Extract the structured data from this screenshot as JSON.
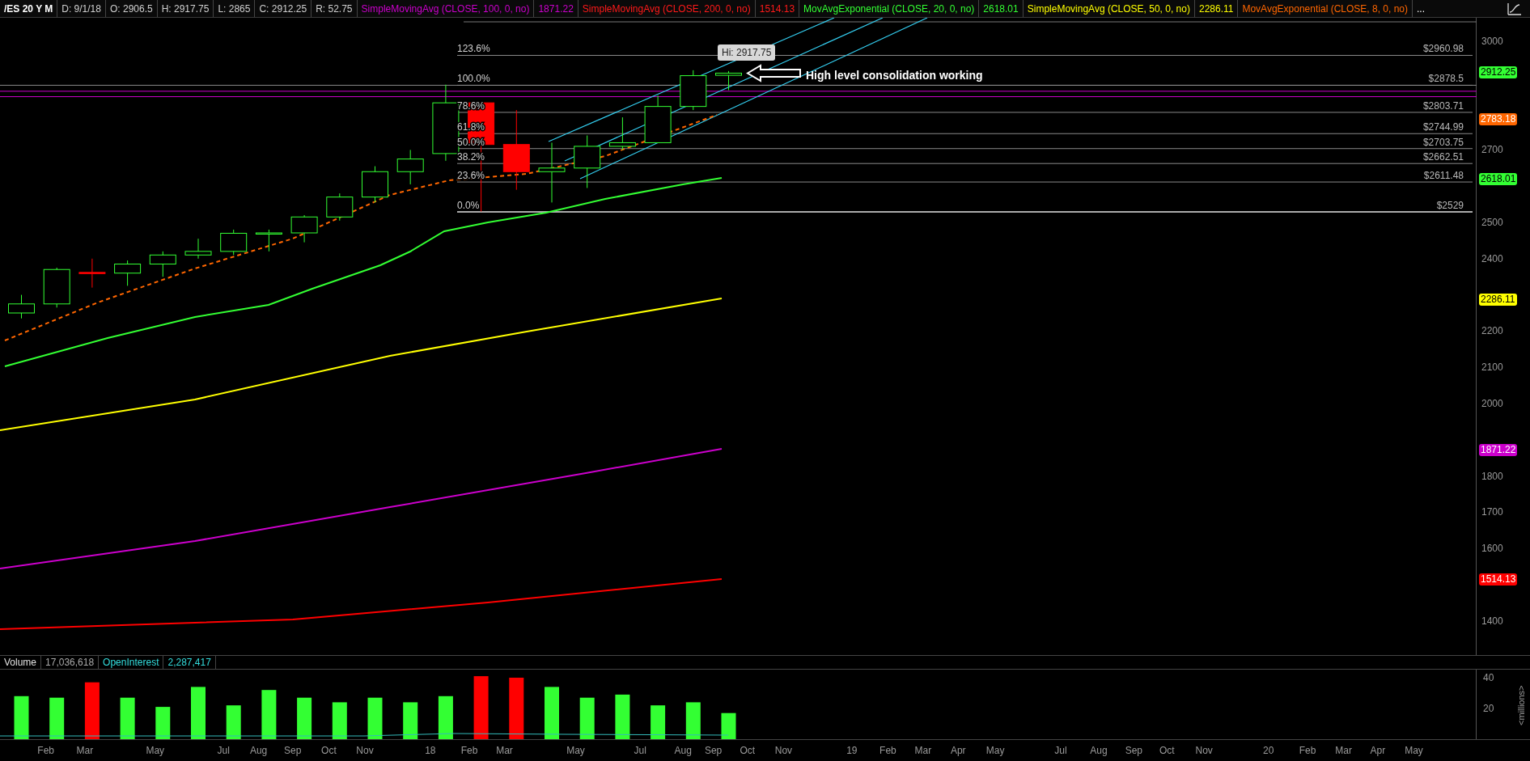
{
  "header": {
    "symbol": "/ES 20 Y M",
    "quote": [
      "D: 9/1/18",
      "O: 2906.5",
      "H: 2917.75",
      "L: 2865",
      "C: 2912.25",
      "R: 52.75"
    ],
    "studies": [
      {
        "name": "SimpleMovingAvg (CLOSE, 100, 0, no)",
        "value": "1871.22",
        "color": "#cc00cc"
      },
      {
        "name": "SimpleMovingAvg (CLOSE, 200, 0, no)",
        "value": "1514.13",
        "color": "#ff1a1a"
      },
      {
        "name": "MovAvgExponential (CLOSE, 20, 0, no)",
        "value": "2618.01",
        "color": "#33ff33"
      },
      {
        "name": "SimpleMovingAvg (CLOSE, 50, 0, no)",
        "value": "2286.11",
        "color": "#ffff00"
      },
      {
        "name": "MovAvgExponential (CLOSE, 8, 0, no)",
        "color": "#ff6600"
      }
    ],
    "more": "..."
  },
  "price_axis": {
    "ticks": [
      "3000",
      "2700",
      "2500",
      "2400",
      "2200",
      "2100",
      "2000",
      "1800",
      "1700",
      "1600",
      "1400"
    ],
    "badges": [
      {
        "value": "2912.25",
        "color": "#33ff33"
      },
      {
        "value": "2783.18",
        "color": "#ff6600"
      },
      {
        "value": "2618.01",
        "color": "#33ff33"
      },
      {
        "value": "2286.11",
        "color": "#ffff00"
      },
      {
        "value": "1871.22",
        "color": "#cc00cc"
      },
      {
        "value": "1514.13",
        "color": "#ff0000"
      }
    ]
  },
  "fib_levels": [
    {
      "percent": "123.6%",
      "price": "$2960.98"
    },
    {
      "percent": "100.0%",
      "price": "$2878.5"
    },
    {
      "percent": "78.6%",
      "price": "$2803.71"
    },
    {
      "percent": "61.8%",
      "price": "$2744.99"
    },
    {
      "percent": "50.0%",
      "price": "$2703.75"
    },
    {
      "percent": "38.2%",
      "price": "$2662.51"
    },
    {
      "percent": "23.6%",
      "price": "$2611.48"
    },
    {
      "percent": "0.0%",
      "price": "$2529"
    }
  ],
  "tooltip": "Hi: 2917.75",
  "annotation": "High level consolidation working",
  "volume_panel": {
    "legend": [
      {
        "value": "17,036,618",
        "color": "#e0e0e0"
      },
      {
        "label": "OpenInterest",
        "value": "2,287,417",
        "color": "#33dddd"
      }
    ],
    "down": [
      false,
      false,
      true,
      false,
      false,
      false,
      false,
      false,
      false,
      false,
      false,
      false,
      false,
      true,
      true,
      false,
      false,
      false,
      false,
      false,
      false
    ],
    "unit": "<millions>",
    "label": "Volume",
    "ticks": [
      "40",
      "20"
    ]
  },
  "time_axis": [
    "Feb",
    "Mar",
    "May",
    "Jul",
    "Aug",
    "Sep",
    "Oct",
    "Nov",
    "18",
    "Feb",
    "Mar",
    "May",
    "Jul",
    "Aug",
    "Sep",
    "Oct",
    "Nov",
    "19",
    "Feb",
    "Mar",
    "Apr",
    "May",
    "Jul",
    "Aug",
    "Sep",
    "Oct",
    "Nov",
    "20",
    "Feb",
    "Mar",
    "Apr",
    "May"
  ]
}
